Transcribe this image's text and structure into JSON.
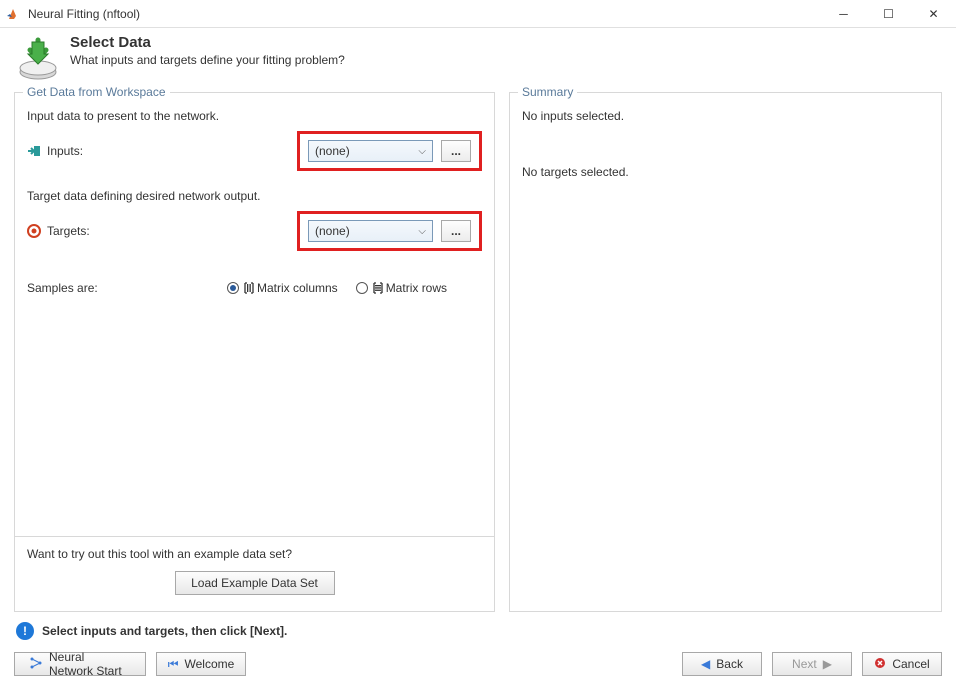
{
  "window": {
    "title": "Neural Fitting (nftool)"
  },
  "header": {
    "title": "Select Data",
    "subtitle": "What inputs and targets define your fitting problem?"
  },
  "leftPanel": {
    "legend": "Get Data from Workspace",
    "inputDesc": "Input data to present to the network.",
    "inputsLabel": "Inputs:",
    "inputsValue": "(none)",
    "browse": "...",
    "targetDesc": "Target data defining desired network output.",
    "targetsLabel": "Targets:",
    "targetsValue": "(none)",
    "samplesLabel": "Samples are:",
    "radioCols": "Matrix columns",
    "radioRows": "Matrix rows",
    "exampleLabel": "Want to try out this tool with an example data set?",
    "exampleBtn": "Load Example Data Set"
  },
  "rightPanel": {
    "legend": "Summary",
    "noInputs": "No inputs selected.",
    "noTargets": "No targets selected."
  },
  "status": {
    "text": "Select inputs and targets, then click [Next]."
  },
  "footer": {
    "nnStart": "Neural Network Start",
    "welcome": "Welcome",
    "back": "Back",
    "next": "Next",
    "cancel": "Cancel"
  }
}
